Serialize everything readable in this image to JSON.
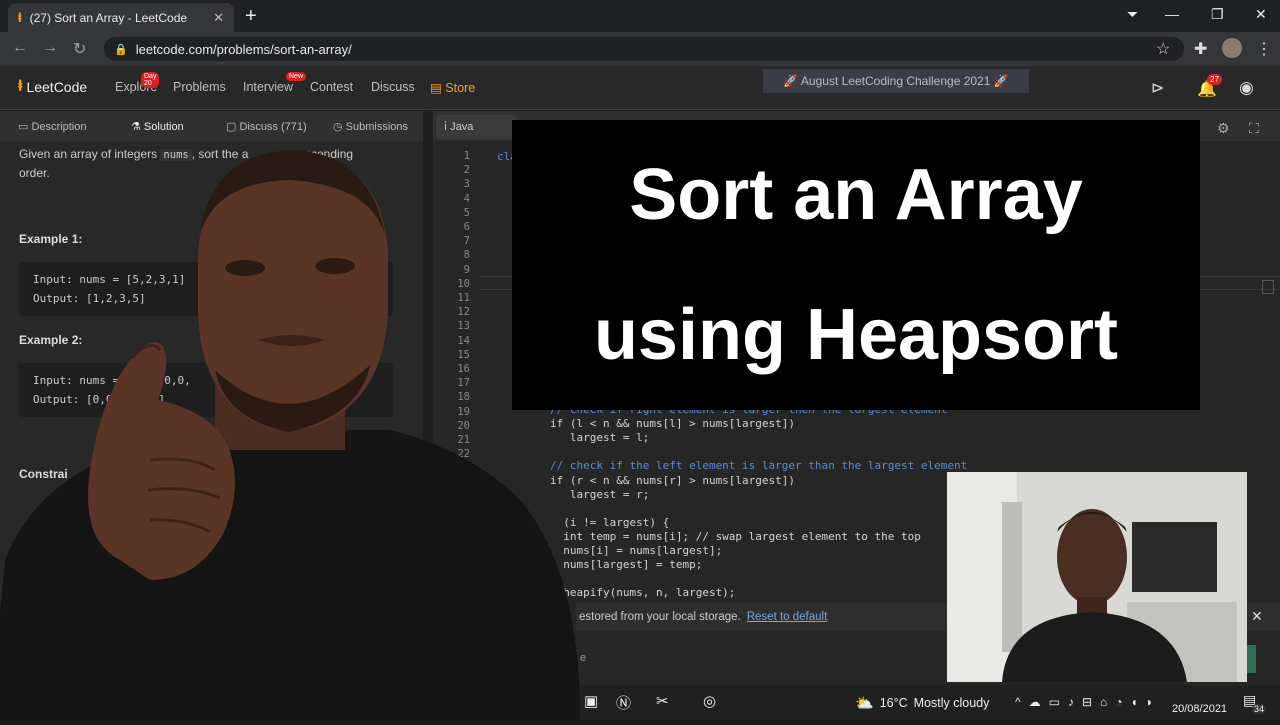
{
  "browser": {
    "tab_title": "(27) Sort an Array - LeetCode",
    "url": "leetcode.com/problems/sort-an-array/"
  },
  "leetcode": {
    "logo_text": "LeetCode",
    "nav": {
      "explore": "Explore",
      "explore_badge": "Day 20",
      "problems": "Problems",
      "interview": "Interview",
      "interview_badge": "New",
      "contest": "Contest",
      "discuss": "Discuss",
      "store": "Store"
    },
    "challenge_banner": "🚀 August LeetCoding Challenge 2021 🚀",
    "notification_count": "27",
    "subtabs": {
      "description": "Description",
      "solution": "Solution",
      "discuss": "Discuss (771)",
      "submissions": "Submissions"
    },
    "language": "Java"
  },
  "problem": {
    "intro_1": "Given an array of integers",
    "intro_code": "nums",
    "intro_2": ", sort the a",
    "intro_3": "scending",
    "intro_4": "order.",
    "example1_heading": "Example 1:",
    "example1_input": "Input: nums = [5,2,3,1]",
    "example1_output": "Output: [1,2,3,5]",
    "example2_heading": "Example 2:",
    "example2_input": "Input: nums = [5",
    "example2_input_tail": "2,0,0,",
    "example2_output": "Output: [0,0,1",
    "example2_output_tail": "5]",
    "constraints_heading": "Constrai"
  },
  "editor": {
    "line_numbers": [
      "1",
      "2",
      "3",
      "4",
      "5",
      "6",
      "7",
      "8",
      "9",
      "10",
      "11",
      "12",
      "13",
      "14",
      "15",
      "16",
      "17",
      "18",
      "19",
      "20",
      "21",
      "22"
    ],
    "line1_partial": "cla",
    "code_lines": [
      "// check if right element is larger then the largest element",
      "if (l < n && nums[l] > nums[largest])",
      "   largest = l;",
      "",
      "// check if the left element is larger than the largest element",
      "if (r < n && nums[r] > nums[largest])",
      "   largest = r;",
      "",
      "  (i != largest) {",
      "  int temp = nums[i]; // swap largest element to the top",
      "  nums[i] = nums[largest];",
      "  nums[largest] = temp;",
      "",
      "  heapify(nums, n, largest);"
    ]
  },
  "restore_bar": {
    "text": "estored from your local storage.",
    "link": "Reset to default"
  },
  "console_partial": "e",
  "title_card": {
    "line1": "Sort an Array",
    "line2": "using Heapsort"
  },
  "taskbar": {
    "temperature": "16°C",
    "weather": "Mostly cloudy",
    "date": "20/08/2021",
    "notification_count": "34"
  },
  "colors": {
    "leetcode_orange": "#f89f1b",
    "title_card_bg": "#000000",
    "title_card_text": "#ffffff"
  }
}
